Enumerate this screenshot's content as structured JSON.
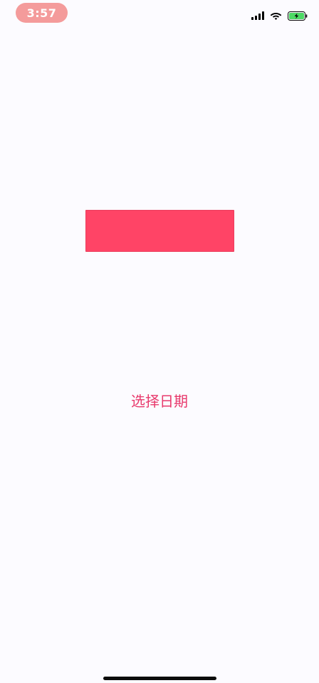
{
  "status_bar": {
    "time": "3:57",
    "icons": [
      "signal-icon",
      "wifi-icon",
      "battery-charging-icon"
    ],
    "battery_color": "#4cd964"
  },
  "main": {
    "color_block_color": "#ff4466",
    "select_date_label": "选择日期",
    "accent_color": "#e83a6d"
  }
}
